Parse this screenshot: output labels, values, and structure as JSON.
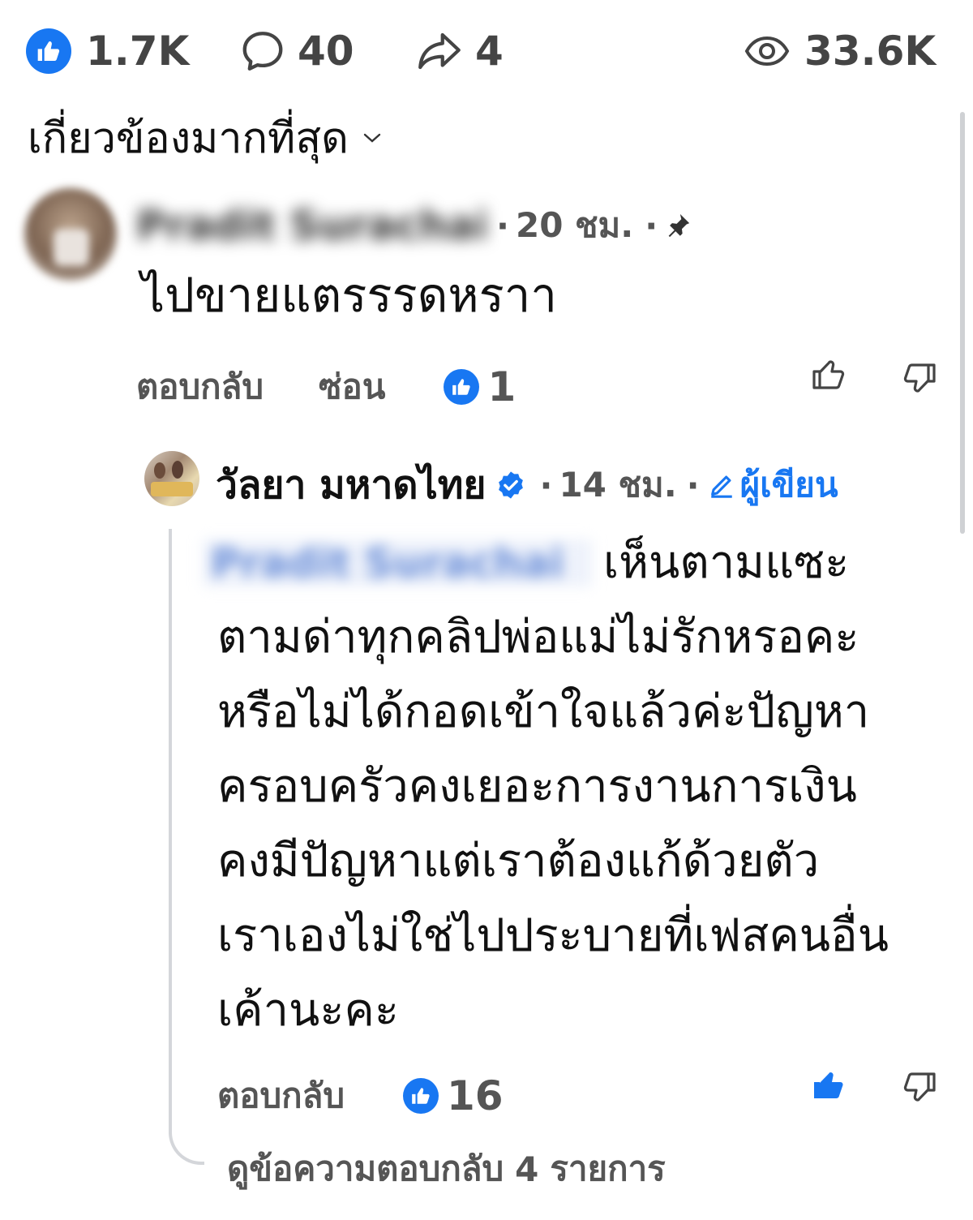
{
  "stats": {
    "reactions": "1.7K",
    "comments": "40",
    "shares": "4",
    "views": "33.6K"
  },
  "sort": {
    "label": "เกี่ยวข้องมากที่สุด"
  },
  "comments": [
    {
      "author": "Pradit Surachai",
      "time": "20 ชม.",
      "text": "ไปขายแตรรรดหราา",
      "actions": {
        "reply": "ตอบกลับ",
        "hide": "ซ่อน"
      },
      "likes": "1"
    }
  ],
  "reply": {
    "author": "วัลยา มหาดไทย",
    "time": "14 ชม.",
    "author_tag": "ผู้เขียน",
    "mention": "Pradit Surachai",
    "first_line": "เห็นตามแซะ",
    "lines": [
      "ตามด่าทุกคลิปพ่อแม่ไม่รักหรอคะ",
      "หรือไม่ได้กอดเข้าใจแล้วค่ะปัญหา",
      "ครอบครัวคงเยอะการงานการเงิน",
      "คงมีปัญหาแต่เราต้องแก้ด้วยตัว",
      "เราเองไม่ใช่ไปประบายที่เฟสคนอื่น",
      "เค้านะคะ"
    ],
    "reply_label": "ตอบกลับ",
    "likes": "16"
  },
  "view_replies": {
    "prefix": "ดูข้อความตอบกลับ",
    "count": "4",
    "suffix": "รายการ"
  },
  "colors": {
    "accent": "#1877f2",
    "muted": "#555555",
    "text": "#111111"
  }
}
